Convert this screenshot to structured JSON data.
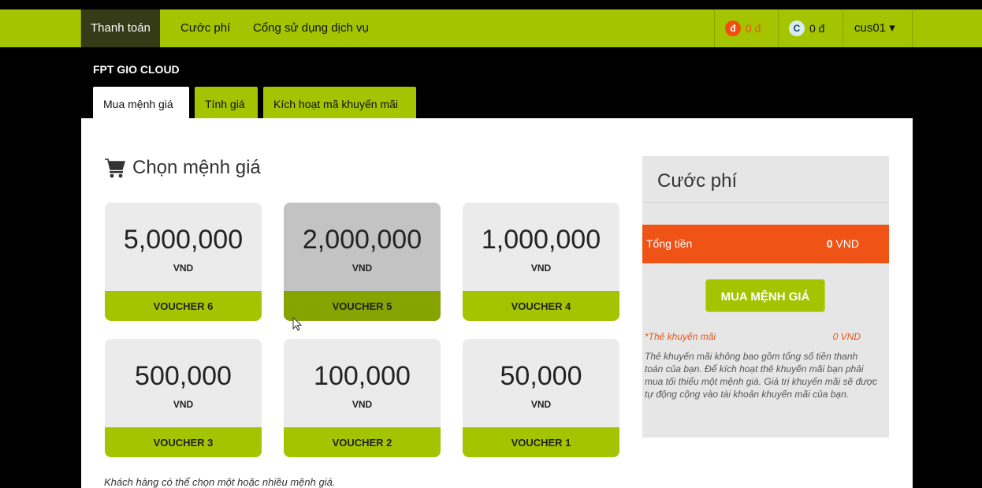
{
  "nav": {
    "items": [
      "Thanh toán",
      "Cước phí",
      "Cổng sử dụng dịch vụ"
    ],
    "balance_d": {
      "symbol": "đ",
      "amount": "0 đ"
    },
    "balance_c": {
      "symbol": "C",
      "amount": "0 đ"
    },
    "user": "cus01 ▾"
  },
  "brand": "FPT GIO CLOUD",
  "tabs": [
    "Mua mệnh giá",
    "Tính giá",
    "Kích hoạt mã khuyến mãi"
  ],
  "section": {
    "title": "Chọn mệnh giá"
  },
  "cards": [
    {
      "amount": "5,000,000",
      "currency": "VND",
      "voucher": "VOUCHER 6"
    },
    {
      "amount": "2,000,000",
      "currency": "VND",
      "voucher": "VOUCHER 5"
    },
    {
      "amount": "1,000,000",
      "currency": "VND",
      "voucher": "VOUCHER 4"
    },
    {
      "amount": "500,000",
      "currency": "VND",
      "voucher": "VOUCHER 3"
    },
    {
      "amount": "100,000",
      "currency": "VND",
      "voucher": "VOUCHER 2"
    },
    {
      "amount": "50,000",
      "currency": "VND",
      "voucher": "VOUCHER 1"
    }
  ],
  "note": "Khách hàng có thể chọn một hoặc nhiều mệnh giá.",
  "summary": {
    "title": "Cước phí",
    "total_label": "Tổng tiền",
    "total_value": "0",
    "total_unit": " VND",
    "buy_button": "MUA MỆNH GIÁ",
    "promo_label": "*Thẻ khuyến mãi",
    "promo_value": "0 VND",
    "promo_desc": "Thẻ khuyến mãi không bao gồm tổng số tiền thanh toán của bạn. Để kích hoạt thẻ khuyến mãi bạn phải mua tối thiểu một mệnh giá. Giá trị khuyến mãi sẽ được tự động cộng vào tài khoản khuyến mãi của bạn."
  },
  "colors": {
    "accent": "#a5c400",
    "orange": "#ef5315",
    "nav_active": "#353b16"
  }
}
